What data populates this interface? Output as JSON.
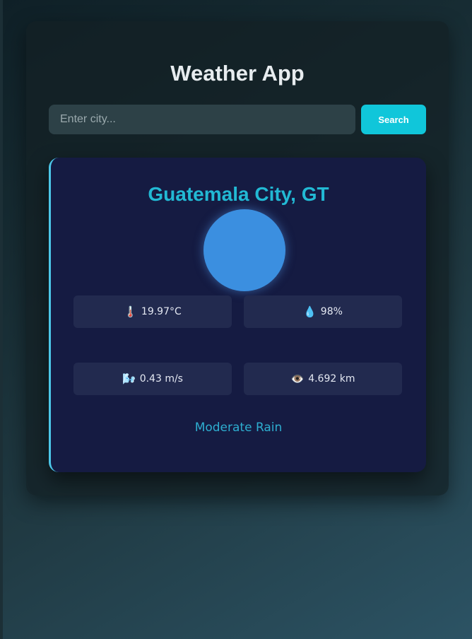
{
  "app": {
    "title": "Weather App"
  },
  "search": {
    "placeholder": "Enter city...",
    "value": "",
    "button_label": "Search"
  },
  "weather": {
    "city": "Guatemala City, GT",
    "icon": "weather-condition-circle",
    "stats": {
      "temperature": {
        "icon": "thermometer-icon",
        "glyph": "🌡️",
        "value": "19.97°C"
      },
      "humidity": {
        "icon": "droplet-icon",
        "glyph": "💧",
        "value": "98%"
      },
      "wind": {
        "icon": "wind-icon",
        "glyph": "🌬️",
        "value": "0.43 m/s"
      },
      "visibility": {
        "icon": "eye-icon",
        "glyph": "👁️",
        "value": "4.692 km"
      }
    },
    "description": "Moderate Rain"
  },
  "colors": {
    "accent": "#10c6da",
    "city_text": "#22b9d4",
    "card_background": "#151b42",
    "icon_circle": "#3b8fe0"
  }
}
